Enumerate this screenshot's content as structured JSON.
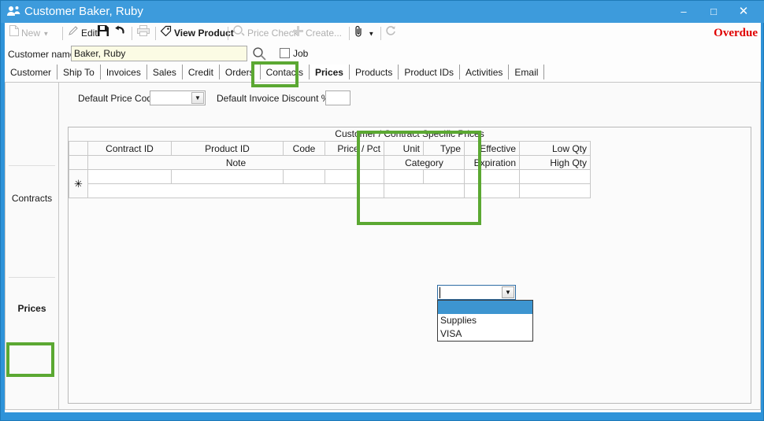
{
  "window": {
    "title": "Customer Baker, Ruby",
    "title_icon": "users-icon",
    "minimize": "–",
    "maximize": "□",
    "close": "✕"
  },
  "toolbar": {
    "new_label": "New",
    "edit_label": "Edit",
    "save_icon": "floppy-disk-icon",
    "undo_icon": "undo-arrow-icon",
    "print_icon": "printer-icon",
    "view_product_label": "View Product",
    "price_check_label": "Price Check",
    "create_label": "Create...",
    "attach_icon": "paperclip-icon",
    "refresh_icon": "refresh-icon",
    "status_text": "Overdue",
    "status_color": "#e00000"
  },
  "customer": {
    "name_label": "Customer name",
    "name_value": "Baker, Ruby",
    "name_placeholder": "",
    "search_icon": "magnifier-icon",
    "job_label": "Job",
    "job_checked": false
  },
  "tabs": [
    {
      "label": "Customer",
      "active": false
    },
    {
      "label": "Ship To",
      "active": false
    },
    {
      "label": "Invoices",
      "active": false
    },
    {
      "label": "Sales",
      "active": false
    },
    {
      "label": "Credit",
      "active": false
    },
    {
      "label": "Orders",
      "active": false
    },
    {
      "label": "Contacts",
      "active": false
    },
    {
      "label": "Prices",
      "active": true
    },
    {
      "label": "Products",
      "active": false
    },
    {
      "label": "Product IDs",
      "active": false
    },
    {
      "label": "Activities",
      "active": false
    },
    {
      "label": "Email",
      "active": false
    }
  ],
  "sidebar": {
    "items": [
      {
        "label": "Contracts",
        "active": false
      },
      {
        "label": "Prices",
        "active": true
      }
    ]
  },
  "defaults": {
    "price_code_label": "Default Price Code",
    "price_code_value": "",
    "invoice_discount_label": "Default Invoice Discount %",
    "invoice_discount_value": ""
  },
  "grid": {
    "caption": "Customer / Contract Specific  Prices",
    "header_row1": [
      "Contract ID",
      "Product ID",
      "Code",
      "Price / Pct",
      "Unit",
      "Type",
      "Effective",
      "Low Qty"
    ],
    "header_row2": [
      "Note",
      "Category",
      "Expiration",
      "High Qty"
    ],
    "new_row_marker": "✳",
    "rows": []
  },
  "category_editor": {
    "value": "",
    "dropdown_arrow": "▼",
    "options": [
      "",
      "Supplies",
      "VISA"
    ],
    "selected_index": 0
  },
  "annotations": {
    "highlight_color": "#5ba832",
    "boxes": [
      "prices-tab",
      "category-dropdown",
      "prices-sidebar-item"
    ]
  }
}
